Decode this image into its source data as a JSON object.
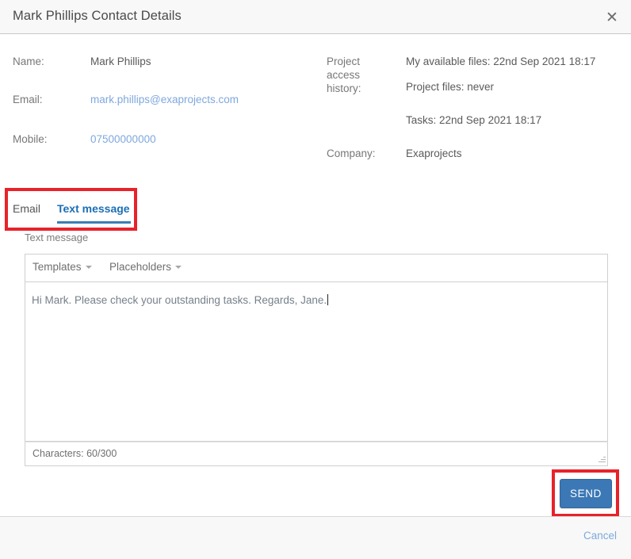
{
  "dialog": {
    "title": "Mark Phillips Contact Details",
    "close_icon": "close-icon",
    "close_glyph": "✕"
  },
  "contact": {
    "name_label": "Name:",
    "name_value": "Mark Phillips",
    "email_label": "Email:",
    "email_value": "mark.phillips@exaprojects.com",
    "mobile_label": "Mobile:",
    "mobile_value": "07500000000"
  },
  "project_info": {
    "access_history_label_line1": "Project",
    "access_history_label_line2": "access",
    "access_history_label_line3": "history:",
    "my_available_files": "My available files: 22nd Sep 2021 18:17",
    "project_files": "Project files: never",
    "tasks": "Tasks: 22nd Sep 2021 18:17",
    "company_label": "Company:",
    "company_value": "Exaprojects"
  },
  "tabs": {
    "email_label": "Email",
    "text_message_label": "Text message",
    "active": "Text message"
  },
  "editor": {
    "field_label": "Text message",
    "templates_label": "Templates",
    "placeholders_label": "Placeholders",
    "message_text": "Hi Mark. Please check your outstanding tasks. Regards, Jane.",
    "character_count": "Characters: 60/300",
    "resize_handle": "resize-grip-icon"
  },
  "actions": {
    "send_label": "SEND",
    "cancel_label": "Cancel"
  },
  "colors": {
    "accent_blue": "#3b78b5",
    "active_tab": "#1a6fb5",
    "link_blue": "#7fa8dd",
    "annotation_red": "#e8222a",
    "header_bg": "#f8f8f8"
  }
}
